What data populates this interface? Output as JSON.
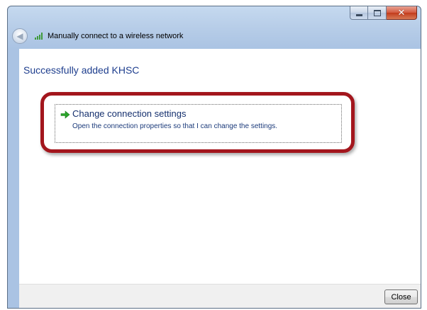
{
  "window": {
    "title": "Manually connect to a wireless network"
  },
  "icons": {
    "back": "back-arrow-icon",
    "network": "wireless-signal-icon",
    "link_arrow": "green-arrow-icon"
  },
  "content": {
    "heading": "Successfully added KHSC",
    "command_link": {
      "title": "Change connection settings",
      "description": "Open the connection properties so that I can change the settings."
    }
  },
  "footer": {
    "close_label": "Close"
  },
  "colors": {
    "heading": "#1e3e8e",
    "highlight_ring": "#a3161d",
    "link_arrow": "#2aa52a"
  }
}
